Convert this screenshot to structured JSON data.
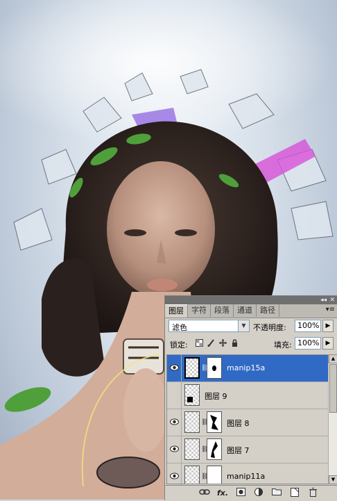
{
  "panel": {
    "topbar": {
      "collapse": "◂◂",
      "close": "✕"
    },
    "tabs": [
      {
        "label": "图层",
        "active": true
      },
      {
        "label": "字符",
        "active": false
      },
      {
        "label": "段落",
        "active": false
      },
      {
        "label": "通道",
        "active": false
      },
      {
        "label": "路径",
        "active": false
      }
    ],
    "menu_icon": "▾≡",
    "blend_mode": "滤色",
    "blend_arrow": "▼",
    "opacity_label": "不透明度:",
    "opacity_value": "100%",
    "lock_label": "锁定:",
    "fill_label": "填充:",
    "fill_value": "100%",
    "spin_arrow": "▶",
    "layers": [
      {
        "name": "manip15a",
        "visible": true,
        "selected": true,
        "has_mask": true
      },
      {
        "name": "图层 9",
        "visible": false,
        "selected": false,
        "has_mask": false
      },
      {
        "name": "图层 8",
        "visible": true,
        "selected": false,
        "has_mask": true
      },
      {
        "name": "图层 7",
        "visible": true,
        "selected": false,
        "has_mask": true
      },
      {
        "name": "manip11a",
        "visible": true,
        "selected": false,
        "has_mask": true
      }
    ],
    "bottom_icons": [
      "link-icon",
      "fx-icon",
      "mask-icon",
      "adjustment-icon",
      "folder-icon",
      "new-layer-icon",
      "trash-icon"
    ],
    "glyphs": {
      "chain": "⛓",
      "fx": "fx.",
      "scroll_up": "▲",
      "scroll_down": "▼"
    },
    "colors": {
      "selection": "#316ac5",
      "panel_bg": "#d4d0c8"
    }
  }
}
